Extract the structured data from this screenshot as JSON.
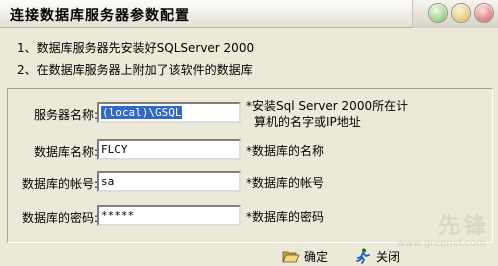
{
  "window": {
    "title": "连接数据库服务器参数配置"
  },
  "notes": [
    "1、数据库服务器先安装好SQLServer 2000",
    "2、在数据库服务器上附加了该软件的数据库"
  ],
  "form": {
    "server": {
      "label": "服务器名称:",
      "value": "(local)\\GSQL",
      "hint_line1": "*安装Sql Server 2000所在计",
      "hint_line2": "算机的名字或IP地址"
    },
    "database": {
      "label": "数据库名称:",
      "value": "FLCY",
      "hint": "*数据库的名称"
    },
    "account": {
      "label": "数据库的帐号:",
      "value": "sa",
      "hint": "*数据库的帐号"
    },
    "password": {
      "label": "数据库的密码:",
      "value": "*****",
      "hint": "*数据库的密码"
    }
  },
  "buttons": {
    "ok_label": "确定",
    "close_label": "关闭"
  },
  "icons": {
    "ok": "folder-open-icon",
    "close": "running-man-icon",
    "window_min": "minimize-icon",
    "window_max": "maximize-icon",
    "window_close": "close-icon"
  },
  "watermark": {
    "text": "先锋",
    "url": "www.greenxf.com"
  }
}
